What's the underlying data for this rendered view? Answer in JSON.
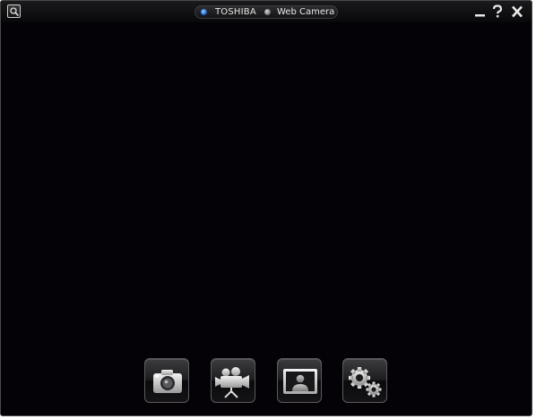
{
  "titlebar": {
    "brand": "TOSHIBA",
    "app_name": "Web Camera",
    "zoom_icon": "magnifier-icon",
    "minimize_icon": "minimize-icon",
    "help_icon": "help-icon",
    "close_icon": "close-icon"
  },
  "toolbar": {
    "buttons": [
      {
        "icon": "camera-icon"
      },
      {
        "icon": "video-camera-icon"
      },
      {
        "icon": "portrait-frame-icon"
      },
      {
        "icon": "gears-icon"
      }
    ]
  },
  "colors": {
    "viewport_background": "#040206",
    "brand_dot": "#1c67d6"
  }
}
